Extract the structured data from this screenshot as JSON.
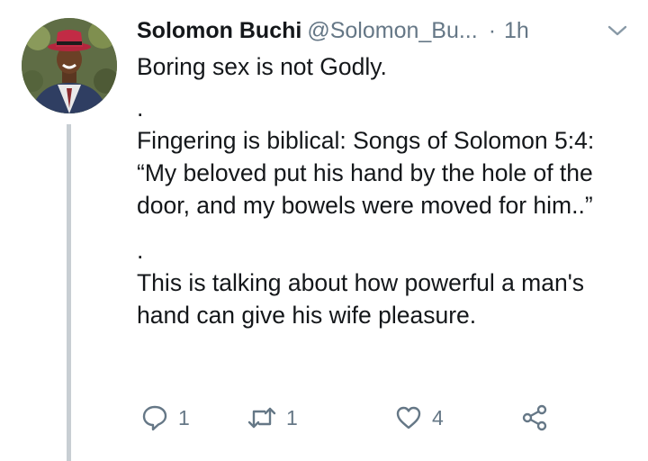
{
  "tweet": {
    "author_name": "Solomon Buchi",
    "author_handle": "@Solomon_Bu...",
    "separator": "·",
    "time": "1h",
    "text_lines": [
      "Boring sex is not Godly.",
      ".",
      "Fingering is biblical: Songs of Solomon 5:4: “My beloved put his hand by the hole of the door, and my bowels were moved for him..”",
      ".",
      "This is talking about how powerful a man's hand can give his wife pleasure."
    ],
    "reply_count": "1",
    "retweet_count": "1",
    "like_count": "4"
  },
  "icons": {
    "avatar": "avatar-photo",
    "caret": "chevron-down-icon",
    "reply": "reply-icon",
    "retweet": "retweet-icon",
    "like": "heart-icon",
    "share": "share-icon"
  },
  "colors": {
    "text": "#14171a",
    "secondary": "#657786",
    "thread_line": "#c8ced3"
  }
}
